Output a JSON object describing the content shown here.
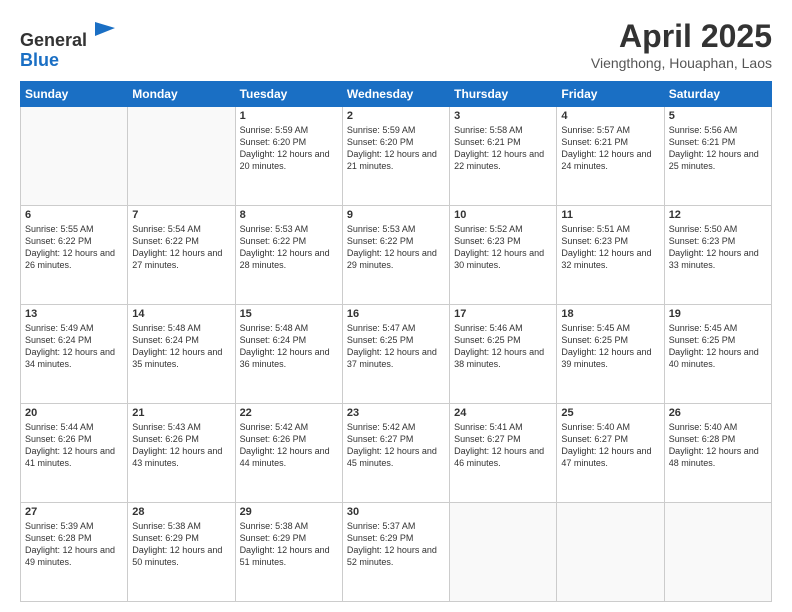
{
  "header": {
    "logo_line1": "General",
    "logo_line2": "Blue",
    "main_title": "April 2025",
    "subtitle": "Viengthong, Houaphan, Laos"
  },
  "weekdays": [
    "Sunday",
    "Monday",
    "Tuesday",
    "Wednesday",
    "Thursday",
    "Friday",
    "Saturday"
  ],
  "weeks": [
    [
      {
        "day": "",
        "info": ""
      },
      {
        "day": "",
        "info": ""
      },
      {
        "day": "1",
        "info": "Sunrise: 5:59 AM\nSunset: 6:20 PM\nDaylight: 12 hours and 20 minutes."
      },
      {
        "day": "2",
        "info": "Sunrise: 5:59 AM\nSunset: 6:20 PM\nDaylight: 12 hours and 21 minutes."
      },
      {
        "day": "3",
        "info": "Sunrise: 5:58 AM\nSunset: 6:21 PM\nDaylight: 12 hours and 22 minutes."
      },
      {
        "day": "4",
        "info": "Sunrise: 5:57 AM\nSunset: 6:21 PM\nDaylight: 12 hours and 24 minutes."
      },
      {
        "day": "5",
        "info": "Sunrise: 5:56 AM\nSunset: 6:21 PM\nDaylight: 12 hours and 25 minutes."
      }
    ],
    [
      {
        "day": "6",
        "info": "Sunrise: 5:55 AM\nSunset: 6:22 PM\nDaylight: 12 hours and 26 minutes."
      },
      {
        "day": "7",
        "info": "Sunrise: 5:54 AM\nSunset: 6:22 PM\nDaylight: 12 hours and 27 minutes."
      },
      {
        "day": "8",
        "info": "Sunrise: 5:53 AM\nSunset: 6:22 PM\nDaylight: 12 hours and 28 minutes."
      },
      {
        "day": "9",
        "info": "Sunrise: 5:53 AM\nSunset: 6:22 PM\nDaylight: 12 hours and 29 minutes."
      },
      {
        "day": "10",
        "info": "Sunrise: 5:52 AM\nSunset: 6:23 PM\nDaylight: 12 hours and 30 minutes."
      },
      {
        "day": "11",
        "info": "Sunrise: 5:51 AM\nSunset: 6:23 PM\nDaylight: 12 hours and 32 minutes."
      },
      {
        "day": "12",
        "info": "Sunrise: 5:50 AM\nSunset: 6:23 PM\nDaylight: 12 hours and 33 minutes."
      }
    ],
    [
      {
        "day": "13",
        "info": "Sunrise: 5:49 AM\nSunset: 6:24 PM\nDaylight: 12 hours and 34 minutes."
      },
      {
        "day": "14",
        "info": "Sunrise: 5:48 AM\nSunset: 6:24 PM\nDaylight: 12 hours and 35 minutes."
      },
      {
        "day": "15",
        "info": "Sunrise: 5:48 AM\nSunset: 6:24 PM\nDaylight: 12 hours and 36 minutes."
      },
      {
        "day": "16",
        "info": "Sunrise: 5:47 AM\nSunset: 6:25 PM\nDaylight: 12 hours and 37 minutes."
      },
      {
        "day": "17",
        "info": "Sunrise: 5:46 AM\nSunset: 6:25 PM\nDaylight: 12 hours and 38 minutes."
      },
      {
        "day": "18",
        "info": "Sunrise: 5:45 AM\nSunset: 6:25 PM\nDaylight: 12 hours and 39 minutes."
      },
      {
        "day": "19",
        "info": "Sunrise: 5:45 AM\nSunset: 6:25 PM\nDaylight: 12 hours and 40 minutes."
      }
    ],
    [
      {
        "day": "20",
        "info": "Sunrise: 5:44 AM\nSunset: 6:26 PM\nDaylight: 12 hours and 41 minutes."
      },
      {
        "day": "21",
        "info": "Sunrise: 5:43 AM\nSunset: 6:26 PM\nDaylight: 12 hours and 43 minutes."
      },
      {
        "day": "22",
        "info": "Sunrise: 5:42 AM\nSunset: 6:26 PM\nDaylight: 12 hours and 44 minutes."
      },
      {
        "day": "23",
        "info": "Sunrise: 5:42 AM\nSunset: 6:27 PM\nDaylight: 12 hours and 45 minutes."
      },
      {
        "day": "24",
        "info": "Sunrise: 5:41 AM\nSunset: 6:27 PM\nDaylight: 12 hours and 46 minutes."
      },
      {
        "day": "25",
        "info": "Sunrise: 5:40 AM\nSunset: 6:27 PM\nDaylight: 12 hours and 47 minutes."
      },
      {
        "day": "26",
        "info": "Sunrise: 5:40 AM\nSunset: 6:28 PM\nDaylight: 12 hours and 48 minutes."
      }
    ],
    [
      {
        "day": "27",
        "info": "Sunrise: 5:39 AM\nSunset: 6:28 PM\nDaylight: 12 hours and 49 minutes."
      },
      {
        "day": "28",
        "info": "Sunrise: 5:38 AM\nSunset: 6:29 PM\nDaylight: 12 hours and 50 minutes."
      },
      {
        "day": "29",
        "info": "Sunrise: 5:38 AM\nSunset: 6:29 PM\nDaylight: 12 hours and 51 minutes."
      },
      {
        "day": "30",
        "info": "Sunrise: 5:37 AM\nSunset: 6:29 PM\nDaylight: 12 hours and 52 minutes."
      },
      {
        "day": "",
        "info": ""
      },
      {
        "day": "",
        "info": ""
      },
      {
        "day": "",
        "info": ""
      }
    ]
  ]
}
